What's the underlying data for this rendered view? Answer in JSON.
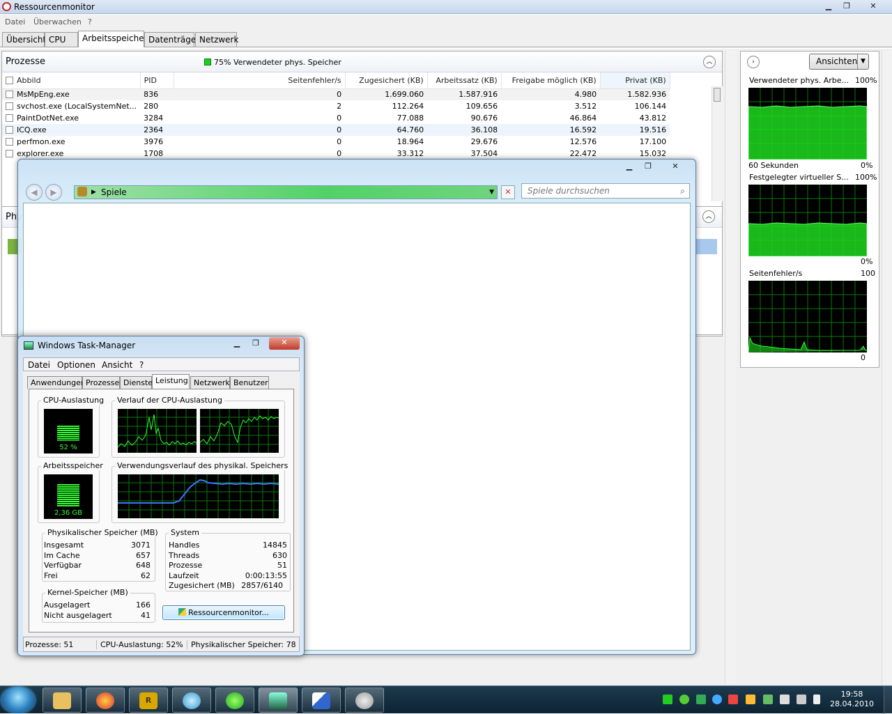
{
  "resmon": {
    "title": "Ressourcenmonitor",
    "menu": [
      "Datei",
      "Überwachen",
      "?"
    ],
    "tabs": [
      "Übersicht",
      "CPU",
      "Arbeitsspeicher",
      "Datenträger",
      "Netzwerk"
    ],
    "active_tab": "Arbeitsspeicher",
    "processes": {
      "header": "Prozesse",
      "status": "75% Verwendeter phys. Speicher",
      "columns": [
        "Abbild",
        "PID",
        "Seitenfehler/s",
        "Zugesichert (KB)",
        "Arbeitssatz (KB)",
        "Freigabe möglich (KB)",
        "Privat (KB)"
      ],
      "rows": [
        [
          "MsMpEng.exe",
          "836",
          "0",
          "1.699.060",
          "1.587.916",
          "4.980",
          "1.582.936"
        ],
        [
          "svchost.exe (LocalSystemNet...",
          "280",
          "2",
          "112.264",
          "109.656",
          "3.512",
          "106.144"
        ],
        [
          "PaintDotNet.exe",
          "3284",
          "0",
          "77.088",
          "90.676",
          "46.864",
          "43.812"
        ],
        [
          "ICQ.exe",
          "2364",
          "0",
          "64.760",
          "36.108",
          "16.592",
          "19.516"
        ],
        [
          "perfmon.exe",
          "3976",
          "0",
          "18.964",
          "29.676",
          "12.576",
          "17.100"
        ],
        [
          "explorer.exe",
          "1708",
          "0",
          "33.312",
          "37.504",
          "22.472",
          "15.032"
        ]
      ]
    },
    "physical_header": "Phy",
    "view_button": "Ansichten",
    "graphs": [
      {
        "label": "Verwendeter phys. Arbe...",
        "top": "100%",
        "bottom_left": "60 Sekunden",
        "bottom_right": "0%"
      },
      {
        "label": "Festgelegter virtueller S...",
        "top": "100%",
        "bottom_left": "",
        "bottom_right": "0%"
      },
      {
        "label": "Seitenfehler/s",
        "top": "100",
        "bottom_left": "",
        "bottom_right": "0"
      }
    ]
  },
  "explorer": {
    "address": "Spiele",
    "search_placeholder": "Spiele durchsuchen"
  },
  "taskmgr": {
    "title": "Windows Task-Manager",
    "menu": [
      "Datei",
      "Optionen",
      "Ansicht",
      "?"
    ],
    "tabs": [
      "Anwendungen",
      "Prozesse",
      "Dienste",
      "Leistung",
      "Netzwerk",
      "Benutzer"
    ],
    "active_tab": "Leistung",
    "cpu_label": "CPU-Auslastung",
    "cpu_value": "52 %",
    "cpu_percent": 52,
    "cpu_history_label": "Verlauf der CPU-Auslastung",
    "mem_label": "Arbeitsspeicher",
    "mem_value": "2,36 GB",
    "mem_percent": 77,
    "mem_history_label": "Verwendungsverlauf des physikal. Speichers",
    "phys": {
      "caption": "Physikalischer Speicher (MB)",
      "items": [
        [
          "Insgesamt",
          "3071"
        ],
        [
          "Im Cache",
          "657"
        ],
        [
          "Verfügbar",
          "648"
        ],
        [
          "Frei",
          "62"
        ]
      ]
    },
    "system": {
      "caption": "System",
      "items": [
        [
          "Handles",
          "14845"
        ],
        [
          "Threads",
          "630"
        ],
        [
          "Prozesse",
          "51"
        ],
        [
          "Laufzeit",
          "0:00:13:55"
        ],
        [
          "Zugesichert (MB)",
          "2857/6140"
        ]
      ]
    },
    "kernel": {
      "caption": "Kernel-Speicher (MB)",
      "items": [
        [
          "Ausgelagert",
          "166"
        ],
        [
          "Nicht ausgelagert",
          "41"
        ]
      ]
    },
    "resmon_button": "Ressourcenmonitor...",
    "status": [
      "Prozesse: 51",
      "CPU-Auslastung: 52%",
      "Physikalischer Speicher: 78"
    ]
  },
  "taskbar": {
    "time": "19:58",
    "date": "28.04.2010"
  },
  "colors": {
    "graph_green": "#1fd81f",
    "graph_grid": "#0a7a0a",
    "mem_line": "#3c78ff"
  }
}
